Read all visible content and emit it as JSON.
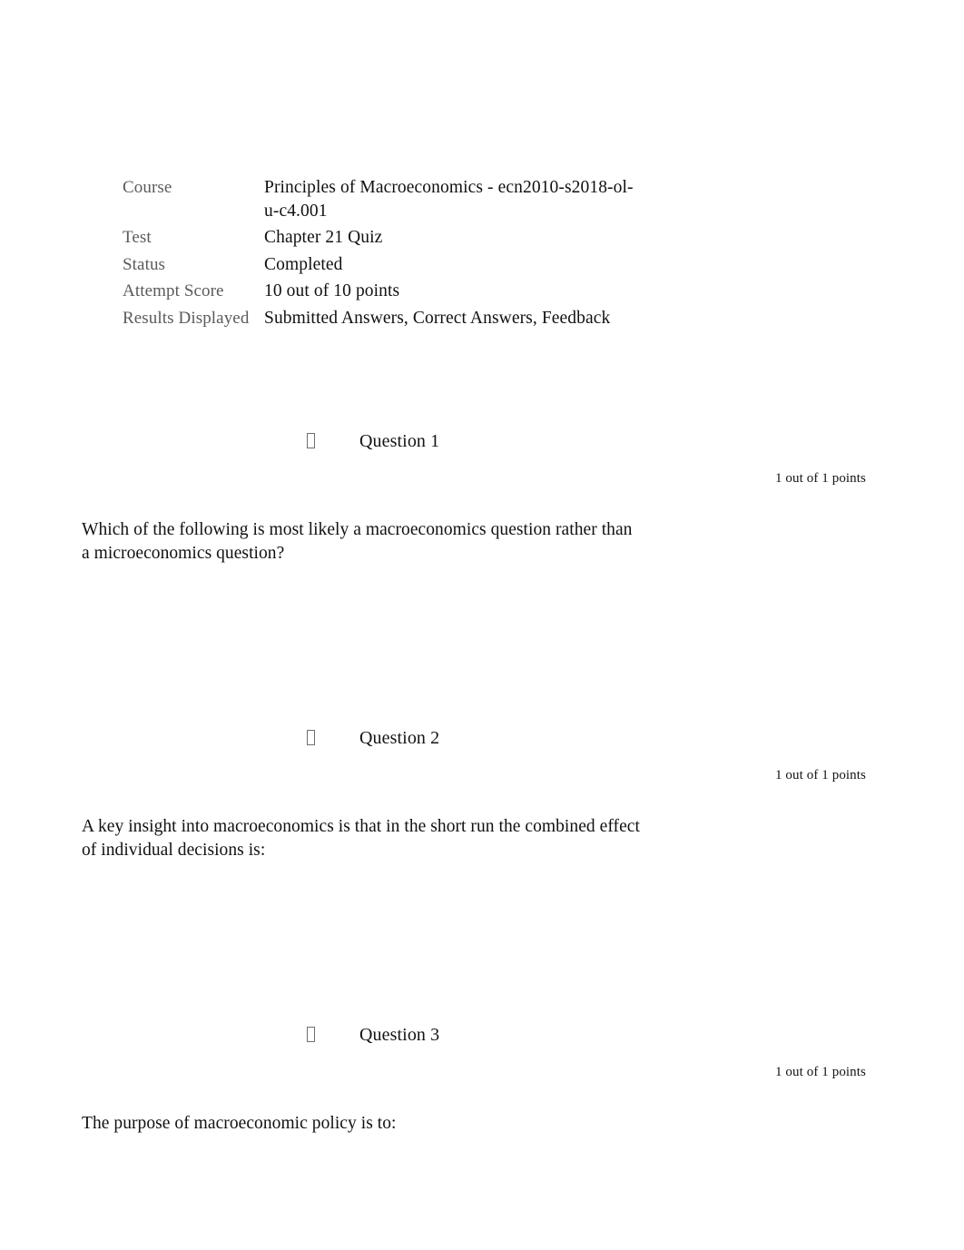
{
  "summary": {
    "rows": [
      {
        "label": "Course",
        "value": "Principles of Macroeconomics - ecn2010-s2018-ol-u-c4.001"
      },
      {
        "label": "Test",
        "value": "Chapter 21 Quiz"
      },
      {
        "label": "Status",
        "value": "Completed"
      },
      {
        "label": "Attempt Score",
        "value": "10 out of 10 points"
      },
      {
        "label": "Results Displayed",
        "value": "Submitted Answers, Correct Answers, Feedback"
      }
    ]
  },
  "questions": [
    {
      "bullet_icon": "missing-glyph-box-icon",
      "title": "Question 1",
      "points": "1 out of 1 points",
      "text": "Which of the following is most likely a macroeconomics question rather than a microeconomics question?",
      "answers": []
    },
    {
      "bullet_icon": "missing-glyph-box-icon",
      "title": "Question 2",
      "points": "1 out of 1 points",
      "text": "A key insight into macroeconomics is that in the short run the combined effect of individual decisions is:",
      "answers": []
    },
    {
      "bullet_icon": "missing-glyph-box-icon",
      "title": "Question 3",
      "points": "1 out of 1 points",
      "text": "The purpose of macroeconomic policy is to:",
      "answers": []
    }
  ],
  "colors": {
    "page_background": "#ffffff",
    "label_text": "#5a5a5a",
    "body_text": "#111111",
    "bullet_outline": "#6e6e6e"
  }
}
